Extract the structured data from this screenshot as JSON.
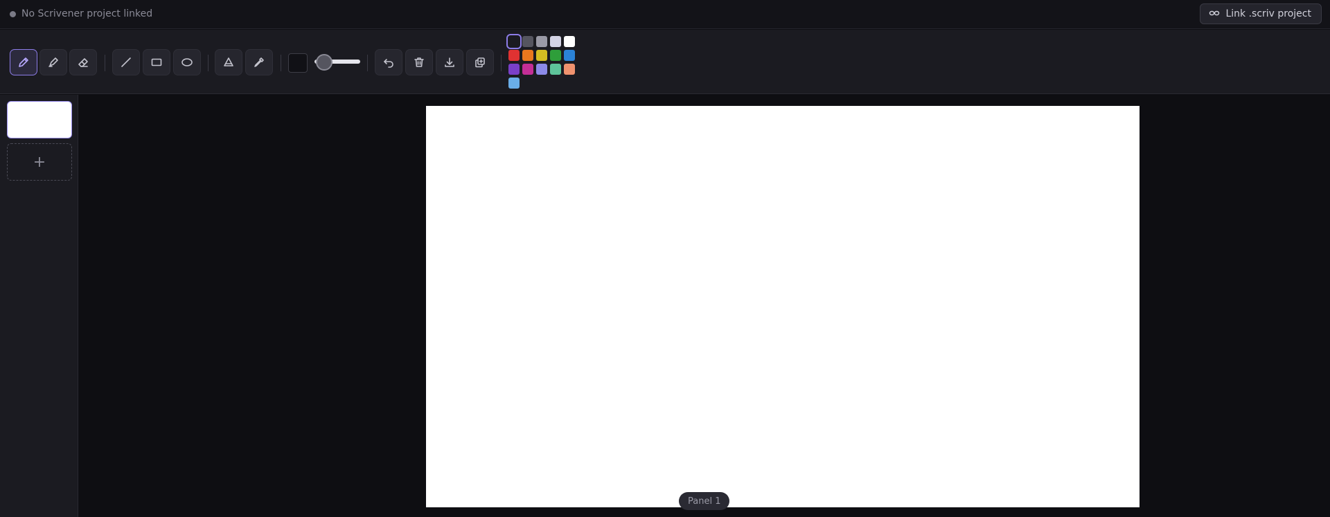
{
  "status": {
    "text": "No Scrivener project linked"
  },
  "link_button": {
    "label": "Link .scriv project",
    "icon": "link-icon"
  },
  "toolbar": {
    "tools": [
      {
        "name": "pencil-tool",
        "icon": "pencil-icon",
        "active": true
      },
      {
        "name": "highlighter-tool",
        "icon": "highlighter-icon",
        "active": false
      },
      {
        "name": "eraser-tool",
        "icon": "eraser-icon",
        "active": false
      },
      {
        "name": "line-tool",
        "icon": "line-icon",
        "active": false
      },
      {
        "name": "rectangle-tool",
        "icon": "rectangle-icon",
        "active": false
      },
      {
        "name": "ellipse-tool",
        "icon": "ellipse-icon",
        "active": false
      },
      {
        "name": "fill-tool",
        "icon": "fill-icon",
        "active": false
      },
      {
        "name": "eyedropper-tool",
        "icon": "eyedropper-icon",
        "active": false
      },
      {
        "name": "undo-button",
        "icon": "undo-icon",
        "active": false
      },
      {
        "name": "clear-button",
        "icon": "trash-icon",
        "active": false
      },
      {
        "name": "download-button",
        "icon": "download-icon",
        "active": false
      },
      {
        "name": "duplicate-button",
        "icon": "duplicate-icon",
        "active": false
      }
    ],
    "stroke_color": "#111116",
    "brush_size_label": "4px",
    "brush_size_fraction": 0.05,
    "palette": [
      "#1b1b21",
      "#55555f",
      "#9a9aa6",
      "#d4d4e6",
      "#ffffff",
      "#e03232",
      "#e8781e",
      "#d4bd22",
      "#2e9e3a",
      "#2b82d6",
      "#7a3fc8",
      "#c42e96",
      "#8c8ae8",
      "#5ec49a",
      "#f0926e",
      "#6aaee8"
    ],
    "selected_palette_index": 0
  },
  "pages": {
    "add_label": "+"
  },
  "canvas": {
    "panel_label": "Panel 1"
  }
}
